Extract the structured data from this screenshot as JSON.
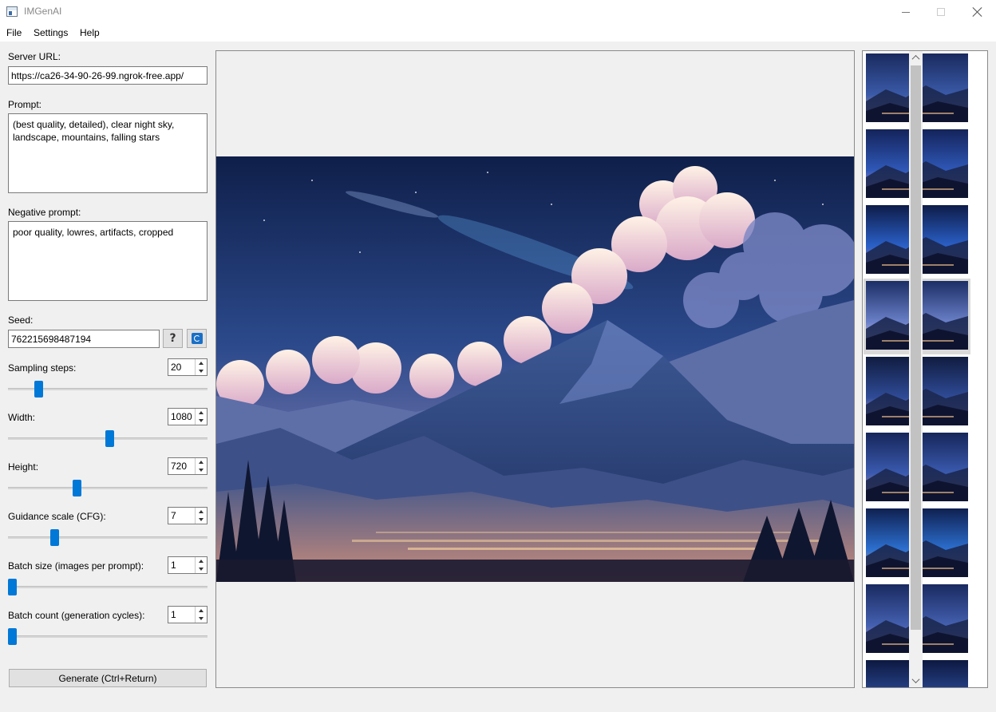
{
  "window": {
    "title": "IMGenAI",
    "app_icon": "app-window-icon"
  },
  "menu": {
    "file": "File",
    "settings": "Settings",
    "help": "Help"
  },
  "form": {
    "server_url_label": "Server URL:",
    "server_url_value": "https://ca26-34-90-26-99.ngrok-free.app/",
    "prompt_label": "Prompt:",
    "prompt_value": "(best quality, detailed), clear night sky,\nlandscape, mountains, falling stars",
    "negative_prompt_label": "Negative prompt:",
    "negative_prompt_value": "poor quality, lowres, artifacts, cropped",
    "seed_label": "Seed:",
    "seed_value": "762215698487194",
    "sampling_steps_label": "Sampling steps:",
    "sampling_steps_value": "20",
    "width_label": "Width:",
    "width_value": "1080",
    "height_label": "Height:",
    "height_value": "720",
    "guidance_label": "Guidance scale (CFG):",
    "guidance_value": "7",
    "batch_size_label": "Batch size (images per prompt):",
    "batch_size_value": "1",
    "batch_count_label": "Batch count (generation cycles):",
    "batch_count_value": "1",
    "generate_label": "Generate (Ctrl+Return)"
  },
  "sliders": {
    "sampling_steps_fraction": 0.14,
    "width_fraction": 0.51,
    "height_fraction": 0.34,
    "guidance_fraction": 0.22,
    "batch_size_fraction": 0.0,
    "batch_count_fraction": 0.0
  },
  "colors": {
    "accent": "#0078d7",
    "window_bg": "#f0f0f0"
  },
  "gallery": {
    "thumbnail_count": 9,
    "selected_index": 3
  }
}
